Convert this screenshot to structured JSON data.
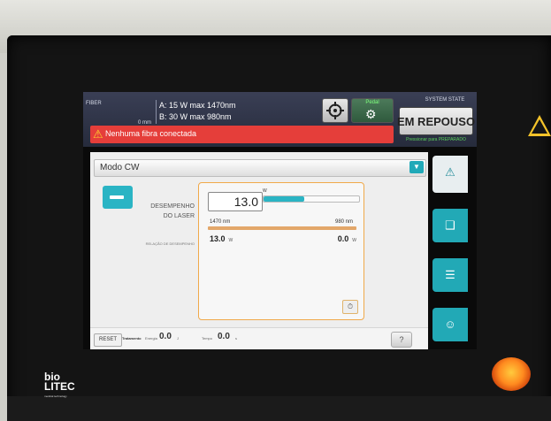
{
  "topbar": {
    "fiber_label": "FIBER",
    "fiber_size": "0 mm",
    "fiber_a": "A: 15 W max 1470nm",
    "fiber_b": "B: 30 W max  980nm",
    "pedal_label": "Pedal",
    "system_state_title": "SYSTEM STATE",
    "state_button": "EM REPOUSO",
    "state_hint": "Pressionar para PREPARADO"
  },
  "alert": {
    "text": "Nenhuma fibra conectada"
  },
  "mode": {
    "selected": "Modo CW"
  },
  "laser": {
    "performance_label_1": "DESEMPENHO",
    "performance_label_2": "DO LASER",
    "relation_label": "RELAÇÃO DE DESEMPENHO",
    "power_value": "13.0",
    "power_unit": "W",
    "power_fraction": 0.43,
    "wl_left": "1470 nm",
    "wl_right": "980 nm",
    "left_value": "13.0",
    "left_unit": "W",
    "right_value": "0.0",
    "right_unit": "W"
  },
  "footer": {
    "reset": "RESET",
    "treatment": "Tratamento",
    "energy_label": "Energia",
    "energy_value": "0.0",
    "energy_unit": "J",
    "time_label": "Tempo",
    "time_value": "0.0",
    "time_unit": "s",
    "help": "?"
  },
  "brand": {
    "line1": "bio",
    "line2": "LITEC",
    "sub": "medical technology"
  },
  "colors": {
    "accent": "#2ab4c4",
    "alert": "#e53e3a",
    "panel_border": "#f0a94a"
  }
}
